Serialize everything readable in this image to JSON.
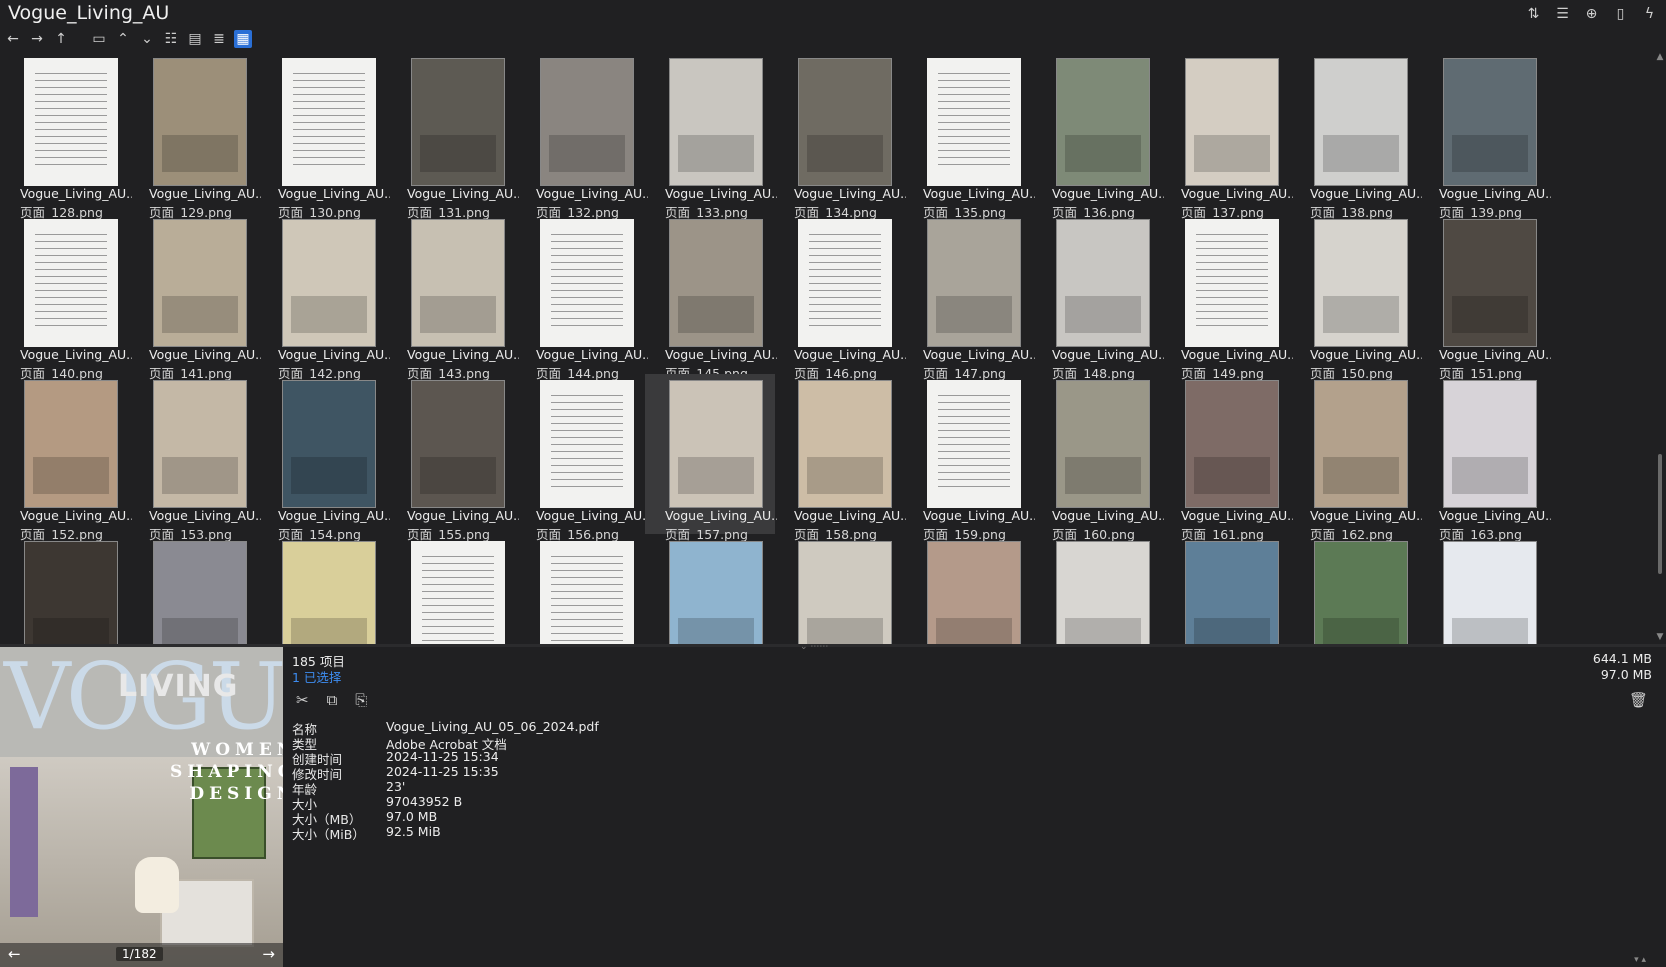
{
  "window": {
    "title": "Vogue_Living_AU",
    "top_icons": [
      "sort-icon",
      "list-settings-icon",
      "add-circle-icon",
      "clipboard-icon",
      "lightning-icon"
    ]
  },
  "toolbar": {
    "nav_icons": [
      "back-arrow-icon",
      "forward-arrow-icon",
      "up-arrow-icon"
    ],
    "buttons": [
      "window-icon",
      "chevron-up-icon",
      "chevron-down-icon",
      "list-view-icon",
      "details-view-icon",
      "tree-view-icon",
      "grid-view-icon"
    ]
  },
  "grid": {
    "name_prefix": "Vogue_Living_AU...",
    "items": [
      {
        "page": "页面_128.png",
        "tone": "white"
      },
      {
        "page": "页面_129.png",
        "tone": "#9c8f79"
      },
      {
        "page": "页面_130.png",
        "tone": "white"
      },
      {
        "page": "页面_131.png",
        "tone": "#5d5a53"
      },
      {
        "page": "页面_132.png",
        "tone": "#8a8580"
      },
      {
        "page": "页面_133.png",
        "tone": "#c9c6c0"
      },
      {
        "page": "页面_134.png",
        "tone": "#6f6b62"
      },
      {
        "page": "页面_135.png",
        "tone": "white"
      },
      {
        "page": "页面_136.png",
        "tone": "#7e8a77"
      },
      {
        "page": "页面_137.png",
        "tone": "#d4cdc2"
      },
      {
        "page": "页面_138.png",
        "tone": "#cfcfcd"
      },
      {
        "page": "页面_139.png",
        "tone": "#5f6b72"
      },
      {
        "page": "页面_140.png",
        "tone": "white"
      },
      {
        "page": "页面_141.png",
        "tone": "#b9ad98"
      },
      {
        "page": "页面_142.png",
        "tone": "#cfc7b8"
      },
      {
        "page": "页面_143.png",
        "tone": "#c7c0b2"
      },
      {
        "page": "页面_144.png",
        "tone": "white"
      },
      {
        "page": "页面_145.png",
        "tone": "#9c9488"
      },
      {
        "page": "页面_146.png",
        "tone": "white"
      },
      {
        "page": "页面_147.png",
        "tone": "#a9a49a"
      },
      {
        "page": "页面_148.png",
        "tone": "#c8c6c2"
      },
      {
        "page": "页面_149.png",
        "tone": "white"
      },
      {
        "page": "页面_150.png",
        "tone": "#d6d3cd"
      },
      {
        "page": "页面_151.png",
        "tone": "#4f4943"
      },
      {
        "page": "页面_152.png",
        "tone": "#b49a82"
      },
      {
        "page": "页面_153.png",
        "tone": "#c4b8a6"
      },
      {
        "page": "页面_154.png",
        "tone": "#3f5563"
      },
      {
        "page": "页面_155.png",
        "tone": "#5c5650"
      },
      {
        "page": "页面_156.png",
        "tone": "white"
      },
      {
        "page": "页面_157.png",
        "tone": "#cbc3b7"
      },
      {
        "page": "页面_158.png",
        "tone": "#cdbda6"
      },
      {
        "page": "页面_159.png",
        "tone": "white"
      },
      {
        "page": "页面_160.png",
        "tone": "#9a9788"
      },
      {
        "page": "页面_161.png",
        "tone": "#7e6b66"
      },
      {
        "page": "页面_162.png",
        "tone": "#b3a18c"
      },
      {
        "page": "页面_163.png",
        "tone": "#d7d3d8"
      },
      {
        "page": "",
        "tone": "#3d3732"
      },
      {
        "page": "",
        "tone": "#8a8a92"
      },
      {
        "page": "",
        "tone": "#d9cf9a"
      },
      {
        "page": "",
        "tone": "white"
      },
      {
        "page": "",
        "tone": "white"
      },
      {
        "page": "",
        "tone": "#8fb4cf"
      },
      {
        "page": "",
        "tone": "#cfcac0"
      },
      {
        "page": "",
        "tone": "#b49a8a"
      },
      {
        "page": "",
        "tone": "#d8d6d2"
      },
      {
        "page": "",
        "tone": "#5e7f98"
      },
      {
        "page": "",
        "tone": "#5c7a55"
      },
      {
        "page": "",
        "tone": "#e6e9ee"
      }
    ],
    "selected_index": 29
  },
  "preview": {
    "cover_title": "VOGUE",
    "cover_subtitle": "LIVING",
    "headline": "WOMEN\nSHAPING\nDESIGN",
    "page_indicator": "1/182",
    "prev_icon": "left-arrow-icon",
    "next_icon": "right-arrow-icon"
  },
  "info": {
    "item_count": "185 项目",
    "selected_count": "1 已选择",
    "total_size": "644.1 MB",
    "selected_size": "97.0 MB",
    "actions": [
      "cut-icon",
      "copy-icon",
      "rename-icon"
    ],
    "properties": [
      {
        "key": "名称",
        "value": "Vogue_Living_AU_05_06_2024.pdf"
      },
      {
        "key": "类型",
        "value": "Adobe Acrobat 文档"
      },
      {
        "key": "创建时间",
        "value": "2024-11-25  15:34"
      },
      {
        "key": "修改时间",
        "value": "2024-11-25  15:35"
      },
      {
        "key": "年龄",
        "value": "23'"
      },
      {
        "key": "大小",
        "value": "97043952 B"
      },
      {
        "key": "大小（MB）",
        "value": "97.0 MB"
      },
      {
        "key": "大小（MiB）",
        "value": "92.5 MiB"
      }
    ]
  }
}
